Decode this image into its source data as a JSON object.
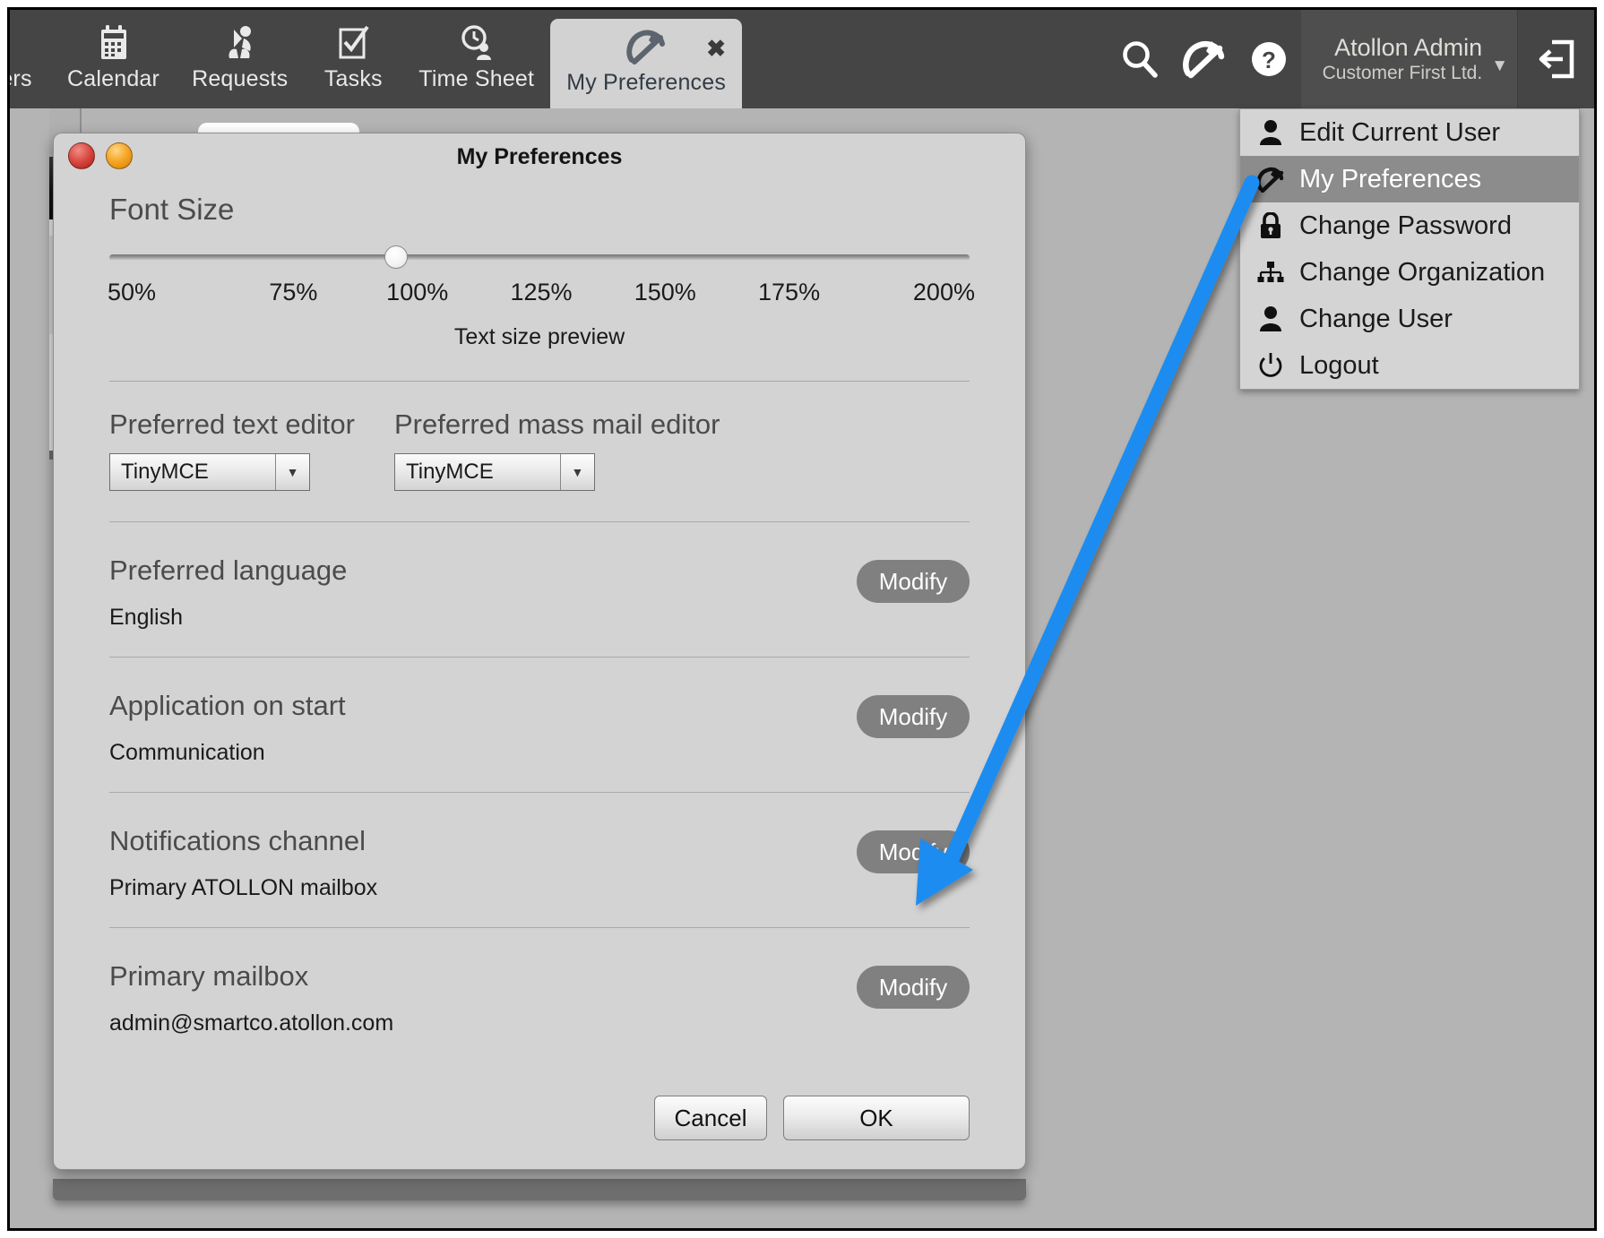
{
  "topnav": {
    "items": [
      {
        "label": "ers",
        "icon": "users-icon",
        "partial": true,
        "active": false
      },
      {
        "label": "Calendar",
        "icon": "calendar-icon",
        "partial": false,
        "active": false
      },
      {
        "label": "Requests",
        "icon": "requests-people-icon",
        "partial": false,
        "active": false
      },
      {
        "label": "Tasks",
        "icon": "tasks-checkbox-icon",
        "partial": false,
        "active": false
      },
      {
        "label": "Time Sheet",
        "icon": "clock-person-icon",
        "partial": false,
        "active": false
      },
      {
        "label": "My Preferences",
        "icon": "wrench-icon",
        "partial": false,
        "active": true
      }
    ],
    "close_tab_glyph": "✖",
    "search_icon": "search-icon",
    "settings_icon": "wrench-icon",
    "help_icon": "question-mark-icon",
    "logout_icon": "logout-arrow-icon",
    "user_name": "Atollon Admin",
    "user_org": "Customer First Ltd.",
    "user_caret": "▼"
  },
  "dropdown": {
    "items": [
      {
        "label": "Edit Current User",
        "icon": "person-icon",
        "selected": false
      },
      {
        "label": "My Preferences",
        "icon": "wrench-icon",
        "selected": true
      },
      {
        "label": "Change Password",
        "icon": "lock-icon",
        "selected": false
      },
      {
        "label": "Change Organization",
        "icon": "org-chart-icon",
        "selected": false
      },
      {
        "label": "Change User",
        "icon": "person-icon",
        "selected": false
      },
      {
        "label": "Logout",
        "icon": "power-icon",
        "selected": false
      }
    ]
  },
  "dialog": {
    "title": "My Preferences",
    "window_close": "close-button",
    "window_minimize": "minimize-button",
    "font_size": {
      "heading": "Font Size",
      "ticks": [
        "50%",
        "75%",
        "100%",
        "125%",
        "150%",
        "175%",
        "200%"
      ],
      "value": "100%",
      "thumb_percent": 33.3,
      "preview_label": "Text size preview"
    },
    "editors": {
      "text_editor_label": "Preferred text editor",
      "text_editor_value": "TinyMCE",
      "mass_mail_label": "Preferred mass mail editor",
      "mass_mail_value": "TinyMCE",
      "caret_glyph": "▼"
    },
    "settings": [
      {
        "title": "Preferred language",
        "value": "English",
        "button": "Modify"
      },
      {
        "title": "Application on start",
        "value": "Communication",
        "button": "Modify"
      },
      {
        "title": "Notifications channel",
        "value": "Primary ATOLLON mailbox",
        "button": "Modify"
      },
      {
        "title": "Primary mailbox",
        "value": "admin@smartco.atollon.com",
        "button": "Modify"
      }
    ],
    "footer": {
      "cancel_label": "Cancel",
      "ok_label": "OK"
    }
  },
  "annotation": {
    "arrow_color": "#1a8cf0",
    "from": "my-preferences-menu-item",
    "to": "primary-mailbox-modify-button"
  },
  "colors": {
    "topbar_bg": "#454545",
    "dialog_bg": "#d3d3d3",
    "app_bg": "#b4b4b4",
    "accent_blue": "#1a8cf0",
    "modify_gray": "#808080",
    "menu_selected": "#8c8c8c"
  }
}
